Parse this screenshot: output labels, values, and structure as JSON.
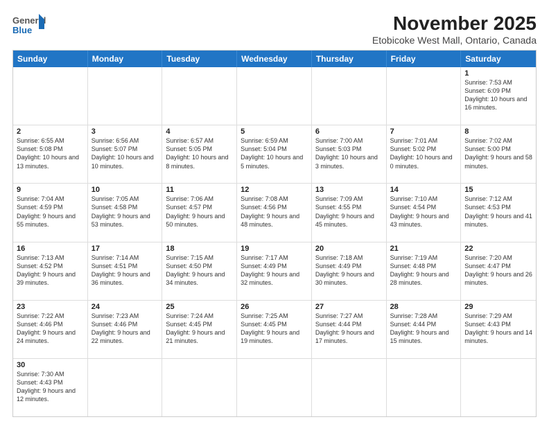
{
  "header": {
    "logo_general": "General",
    "logo_blue": "Blue",
    "title": "November 2025",
    "subtitle": "Etobicoke West Mall, Ontario, Canada"
  },
  "days_of_week": [
    "Sunday",
    "Monday",
    "Tuesday",
    "Wednesday",
    "Thursday",
    "Friday",
    "Saturday"
  ],
  "weeks": [
    [
      {
        "day": "",
        "info": ""
      },
      {
        "day": "",
        "info": ""
      },
      {
        "day": "",
        "info": ""
      },
      {
        "day": "",
        "info": ""
      },
      {
        "day": "",
        "info": ""
      },
      {
        "day": "",
        "info": ""
      },
      {
        "day": "1",
        "info": "Sunrise: 7:53 AM\nSunset: 6:09 PM\nDaylight: 10 hours and 16 minutes."
      }
    ],
    [
      {
        "day": "2",
        "info": "Sunrise: 6:55 AM\nSunset: 5:08 PM\nDaylight: 10 hours and 13 minutes."
      },
      {
        "day": "3",
        "info": "Sunrise: 6:56 AM\nSunset: 5:07 PM\nDaylight: 10 hours and 10 minutes."
      },
      {
        "day": "4",
        "info": "Sunrise: 6:57 AM\nSunset: 5:05 PM\nDaylight: 10 hours and 8 minutes."
      },
      {
        "day": "5",
        "info": "Sunrise: 6:59 AM\nSunset: 5:04 PM\nDaylight: 10 hours and 5 minutes."
      },
      {
        "day": "6",
        "info": "Sunrise: 7:00 AM\nSunset: 5:03 PM\nDaylight: 10 hours and 3 minutes."
      },
      {
        "day": "7",
        "info": "Sunrise: 7:01 AM\nSunset: 5:02 PM\nDaylight: 10 hours and 0 minutes."
      },
      {
        "day": "8",
        "info": "Sunrise: 7:02 AM\nSunset: 5:00 PM\nDaylight: 9 hours and 58 minutes."
      }
    ],
    [
      {
        "day": "9",
        "info": "Sunrise: 7:04 AM\nSunset: 4:59 PM\nDaylight: 9 hours and 55 minutes."
      },
      {
        "day": "10",
        "info": "Sunrise: 7:05 AM\nSunset: 4:58 PM\nDaylight: 9 hours and 53 minutes."
      },
      {
        "day": "11",
        "info": "Sunrise: 7:06 AM\nSunset: 4:57 PM\nDaylight: 9 hours and 50 minutes."
      },
      {
        "day": "12",
        "info": "Sunrise: 7:08 AM\nSunset: 4:56 PM\nDaylight: 9 hours and 48 minutes."
      },
      {
        "day": "13",
        "info": "Sunrise: 7:09 AM\nSunset: 4:55 PM\nDaylight: 9 hours and 45 minutes."
      },
      {
        "day": "14",
        "info": "Sunrise: 7:10 AM\nSunset: 4:54 PM\nDaylight: 9 hours and 43 minutes."
      },
      {
        "day": "15",
        "info": "Sunrise: 7:12 AM\nSunset: 4:53 PM\nDaylight: 9 hours and 41 minutes."
      }
    ],
    [
      {
        "day": "16",
        "info": "Sunrise: 7:13 AM\nSunset: 4:52 PM\nDaylight: 9 hours and 39 minutes."
      },
      {
        "day": "17",
        "info": "Sunrise: 7:14 AM\nSunset: 4:51 PM\nDaylight: 9 hours and 36 minutes."
      },
      {
        "day": "18",
        "info": "Sunrise: 7:15 AM\nSunset: 4:50 PM\nDaylight: 9 hours and 34 minutes."
      },
      {
        "day": "19",
        "info": "Sunrise: 7:17 AM\nSunset: 4:49 PM\nDaylight: 9 hours and 32 minutes."
      },
      {
        "day": "20",
        "info": "Sunrise: 7:18 AM\nSunset: 4:49 PM\nDaylight: 9 hours and 30 minutes."
      },
      {
        "day": "21",
        "info": "Sunrise: 7:19 AM\nSunset: 4:48 PM\nDaylight: 9 hours and 28 minutes."
      },
      {
        "day": "22",
        "info": "Sunrise: 7:20 AM\nSunset: 4:47 PM\nDaylight: 9 hours and 26 minutes."
      }
    ],
    [
      {
        "day": "23",
        "info": "Sunrise: 7:22 AM\nSunset: 4:46 PM\nDaylight: 9 hours and 24 minutes."
      },
      {
        "day": "24",
        "info": "Sunrise: 7:23 AM\nSunset: 4:46 PM\nDaylight: 9 hours and 22 minutes."
      },
      {
        "day": "25",
        "info": "Sunrise: 7:24 AM\nSunset: 4:45 PM\nDaylight: 9 hours and 21 minutes."
      },
      {
        "day": "26",
        "info": "Sunrise: 7:25 AM\nSunset: 4:45 PM\nDaylight: 9 hours and 19 minutes."
      },
      {
        "day": "27",
        "info": "Sunrise: 7:27 AM\nSunset: 4:44 PM\nDaylight: 9 hours and 17 minutes."
      },
      {
        "day": "28",
        "info": "Sunrise: 7:28 AM\nSunset: 4:44 PM\nDaylight: 9 hours and 15 minutes."
      },
      {
        "day": "29",
        "info": "Sunrise: 7:29 AM\nSunset: 4:43 PM\nDaylight: 9 hours and 14 minutes."
      }
    ],
    [
      {
        "day": "30",
        "info": "Sunrise: 7:30 AM\nSunset: 4:43 PM\nDaylight: 9 hours and 12 minutes."
      },
      {
        "day": "",
        "info": ""
      },
      {
        "day": "",
        "info": ""
      },
      {
        "day": "",
        "info": ""
      },
      {
        "day": "",
        "info": ""
      },
      {
        "day": "",
        "info": ""
      },
      {
        "day": "",
        "info": ""
      }
    ]
  ]
}
